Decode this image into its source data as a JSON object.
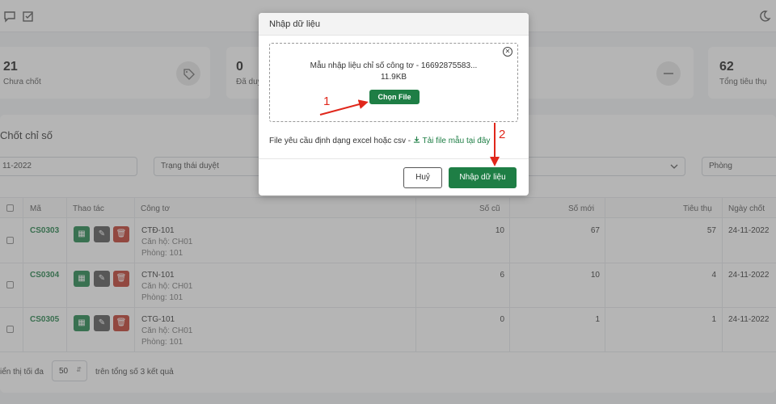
{
  "stats": [
    {
      "value": "21",
      "label": "Chưa chốt"
    },
    {
      "value": "0",
      "label": "Đã duyệt"
    },
    {
      "value": "62",
      "label": "Tổng tiêu thụ"
    }
  ],
  "section_title": "Chốt chỉ số",
  "filters": {
    "date": "11-2022",
    "status": "Trạng thái duyệt",
    "room": "Phòng"
  },
  "table": {
    "headers": {
      "code": "Mã",
      "actions": "Thao tác",
      "meter": "Công tơ",
      "old": "Số cũ",
      "new": "Số mới",
      "usage": "Tiêu thụ",
      "date": "Ngày chốt"
    },
    "rows": [
      {
        "code": "CS0303",
        "meter": "CTĐ-101",
        "apartment": "Căn hộ: CH01",
        "room": "Phòng: 101",
        "old": "10",
        "new": "67",
        "usage": "57",
        "date": "24-11-2022"
      },
      {
        "code": "CS0304",
        "meter": "CTN-101",
        "apartment": "Căn hộ: CH01",
        "room": "Phòng: 101",
        "old": "6",
        "new": "10",
        "usage": "4",
        "date": "24-11-2022"
      },
      {
        "code": "CS0305",
        "meter": "CTG-101",
        "apartment": "Căn hộ: CH01",
        "room": "Phòng: 101",
        "old": "0",
        "new": "1",
        "usage": "1",
        "date": "24-11-2022"
      }
    ]
  },
  "pager": {
    "prefix": "iển thị tối đa",
    "page_size": "50",
    "suffix": "trên tổng số 3 kết quả"
  },
  "modal": {
    "title": "Nhập dữ liệu",
    "file_name": "Mẫu nhập liệu chỉ số công tơ - 16692875583...",
    "file_size": "11.9KB",
    "choose_file": "Chọn File",
    "hint": "File yêu cầu định dạng excel hoặc csv - ",
    "template_link": "Tải file mẫu tại đây",
    "cancel": "Huỷ",
    "submit": "Nhập dữ liệu"
  },
  "annotations": {
    "step1": "1",
    "step2": "2"
  },
  "colors": {
    "primary": "#1e7e45",
    "danger": "#c0392b",
    "annotation": "#e0271b"
  }
}
